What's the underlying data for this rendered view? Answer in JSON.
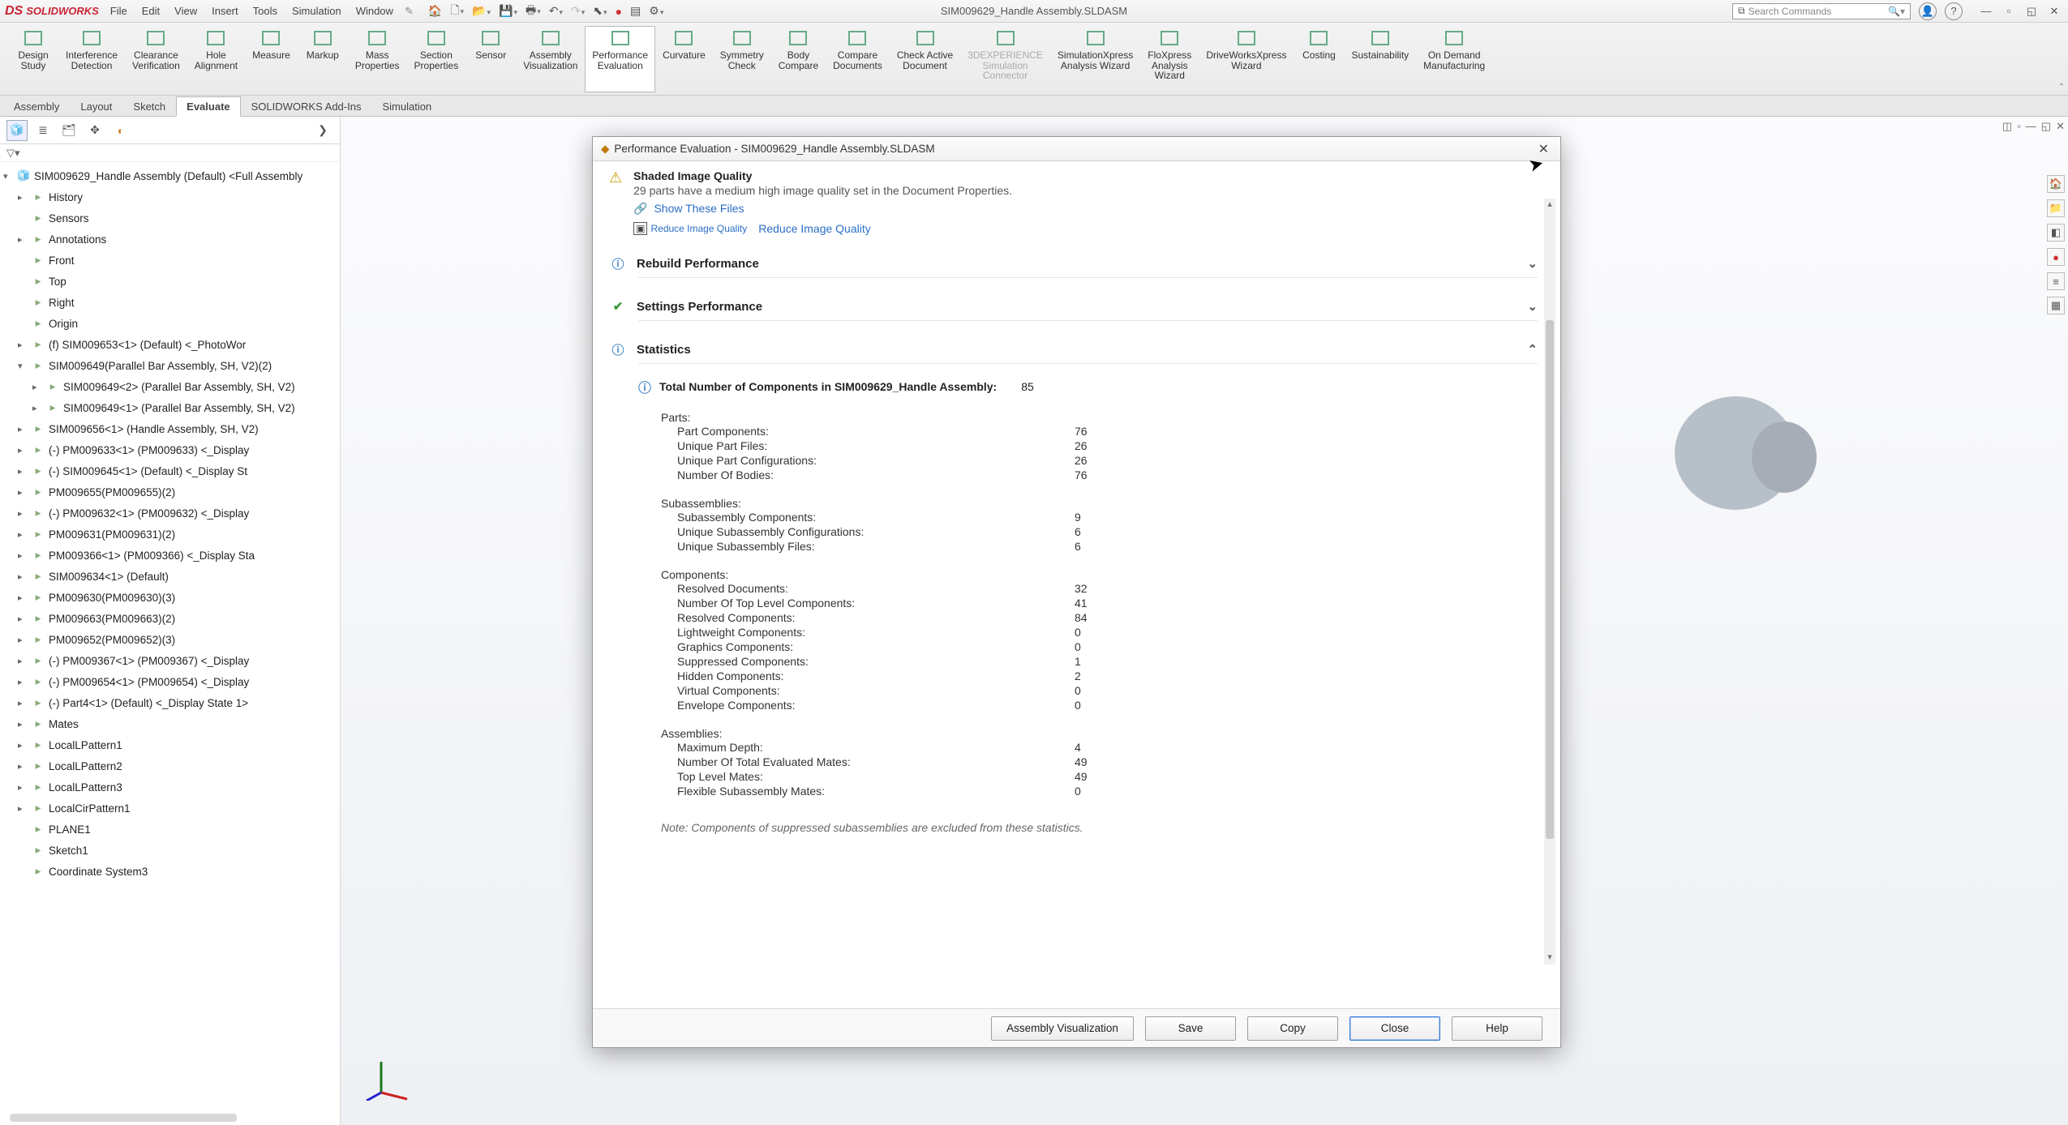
{
  "app": {
    "brand": "SOLIDWORKS",
    "doc_title": "SIM009629_Handle Assembly.SLDASM",
    "search_placeholder": "Search Commands"
  },
  "menus": [
    "File",
    "Edit",
    "View",
    "Insert",
    "Tools",
    "Simulation",
    "Window"
  ],
  "tabs": [
    "Assembly",
    "Layout",
    "Sketch",
    "Evaluate",
    "SOLIDWORKS Add-Ins",
    "Simulation"
  ],
  "active_tab": "Evaluate",
  "ribbon": [
    {
      "id": "design-study",
      "label": "Design\nStudy"
    },
    {
      "id": "interference",
      "label": "Interference\nDetection"
    },
    {
      "id": "clearance",
      "label": "Clearance\nVerification"
    },
    {
      "id": "hole",
      "label": "Hole\nAlignment"
    },
    {
      "id": "measure",
      "label": "Measure"
    },
    {
      "id": "markup",
      "label": "Markup"
    },
    {
      "id": "mass",
      "label": "Mass\nProperties"
    },
    {
      "id": "section",
      "label": "Section\nProperties"
    },
    {
      "id": "sensor",
      "label": "Sensor"
    },
    {
      "id": "asm-vis",
      "label": "Assembly\nVisualization"
    },
    {
      "id": "perf-eval",
      "label": "Performance\nEvaluation",
      "selected": true
    },
    {
      "id": "curvature",
      "label": "Curvature"
    },
    {
      "id": "symmetry",
      "label": "Symmetry\nCheck"
    },
    {
      "id": "body-compare",
      "label": "Body\nCompare"
    },
    {
      "id": "compare-doc",
      "label": "Compare\nDocuments"
    },
    {
      "id": "check-active",
      "label": "Check Active\nDocument"
    },
    {
      "id": "3dx",
      "label": "3DEXPERIENCE\nSimulation\nConnector",
      "disabled": true
    },
    {
      "id": "simx",
      "label": "SimulationXpress\nAnalysis Wizard"
    },
    {
      "id": "flox",
      "label": "FloXpress\nAnalysis\nWizard"
    },
    {
      "id": "dwx",
      "label": "DriveWorksXpress\nWizard"
    },
    {
      "id": "costing",
      "label": "Costing"
    },
    {
      "id": "sust",
      "label": "Sustainability"
    },
    {
      "id": "odm",
      "label": "On Demand\nManufacturing"
    }
  ],
  "tree_root": "SIM009629_Handle Assembly (Default) <Full Assembly",
  "tree": [
    {
      "d": 2,
      "l": "History",
      "ar": "▸"
    },
    {
      "d": 2,
      "l": "Sensors"
    },
    {
      "d": 2,
      "l": "Annotations",
      "ar": "▸"
    },
    {
      "d": 2,
      "l": "Front"
    },
    {
      "d": 2,
      "l": "Top"
    },
    {
      "d": 2,
      "l": "Right"
    },
    {
      "d": 2,
      "l": "Origin"
    },
    {
      "d": 2,
      "l": "(f) SIM009653<1> (Default) <<Default>_PhotoWor",
      "ar": "▸"
    },
    {
      "d": 2,
      "l": "SIM009649(Parallel Bar Assembly, SH, V2)(2)",
      "ar": "▾"
    },
    {
      "d": 3,
      "l": "SIM009649<2> (Parallel Bar Assembly, SH, V2)",
      "ar": "▸"
    },
    {
      "d": 3,
      "l": "SIM009649<1> (Parallel Bar Assembly, SH, V2)",
      "ar": "▸"
    },
    {
      "d": 2,
      "l": "SIM009656<1> (Handle Assembly, SH, V2) <Displa",
      "ar": "▸"
    },
    {
      "d": 2,
      "l": "(-) PM009633<1> (PM009633) <<Default>_Display",
      "ar": "▸"
    },
    {
      "d": 2,
      "l": "(-) SIM009645<1> (Default) <<Default>_Display St",
      "ar": "▸"
    },
    {
      "d": 2,
      "l": "PM009655(PM009655)(2)",
      "ar": "▸"
    },
    {
      "d": 2,
      "l": "(-) PM009632<1> (PM009632) <<Default>_Display",
      "ar": "▸"
    },
    {
      "d": 2,
      "l": "PM009631(PM009631)(2)",
      "ar": "▸"
    },
    {
      "d": 2,
      "l": "PM009366<1> (PM009366) <<Default>_Display Sta",
      "ar": "▸"
    },
    {
      "d": 2,
      "l": "SIM009634<1> (Default) <Display State-1>",
      "ar": "▸"
    },
    {
      "d": 2,
      "l": "PM009630(PM009630)(3)",
      "ar": "▸"
    },
    {
      "d": 2,
      "l": "PM009663(PM009663)(2)",
      "ar": "▸"
    },
    {
      "d": 2,
      "l": "PM009652(PM009652)(3)",
      "ar": "▸"
    },
    {
      "d": 2,
      "l": "(-) PM009367<1> (PM009367) <<Default>_Display",
      "ar": "▸"
    },
    {
      "d": 2,
      "l": "(-) PM009654<1> (PM009654) <<Default>_Display",
      "ar": "▸"
    },
    {
      "d": 2,
      "l": "(-) Part4<1> (Default) <<Default>_Display State 1>",
      "ar": "▸"
    },
    {
      "d": 2,
      "l": "Mates",
      "ar": "▸"
    },
    {
      "d": 2,
      "l": "LocalLPattern1",
      "ar": "▸"
    },
    {
      "d": 2,
      "l": "LocalLPattern2",
      "ar": "▸"
    },
    {
      "d": 2,
      "l": "LocalLPattern3",
      "ar": "▸"
    },
    {
      "d": 2,
      "l": "LocalCirPattern1",
      "ar": "▸"
    },
    {
      "d": 2,
      "l": "PLANE1"
    },
    {
      "d": 2,
      "l": "Sketch1"
    },
    {
      "d": 2,
      "l": "Coordinate System3"
    }
  ],
  "dialog": {
    "title": "Performance Evaluation - SIM009629_Handle Assembly.SLDASM",
    "shaded": {
      "heading": "Shaded Image Quality",
      "msg": "29 parts have a medium high image quality set in the Document Properties.",
      "link1": "Show These Files",
      "icon_label": "Reduce Image Quality",
      "link2": "Reduce Image Quality"
    },
    "sections": [
      {
        "id": "rebuild",
        "title": "Rebuild Performance",
        "icon": "info",
        "chev": "⌄"
      },
      {
        "id": "settings",
        "title": "Settings Performance",
        "icon": "ok",
        "chev": "⌄"
      },
      {
        "id": "stats",
        "title": "Statistics",
        "icon": "info",
        "chev": "⌃"
      }
    ],
    "stats_title": "Total Number of Components in SIM009629_Handle Assembly:",
    "stats_title_val": "85",
    "groups": [
      {
        "title": "Parts:",
        "rows": [
          {
            "k": "Part Components:",
            "v": "76"
          },
          {
            "k": "Unique Part Files:",
            "v": "26"
          },
          {
            "k": "Unique Part Configurations:",
            "v": "26"
          },
          {
            "k": "Number Of Bodies:",
            "v": "76"
          }
        ]
      },
      {
        "title": "Subassemblies:",
        "rows": [
          {
            "k": "Subassembly Components:",
            "v": "9"
          },
          {
            "k": "Unique Subassembly Configurations:",
            "v": "6"
          },
          {
            "k": "Unique Subassembly Files:",
            "v": "6"
          }
        ]
      },
      {
        "title": "Components:",
        "rows": [
          {
            "k": "Resolved Documents:",
            "v": "32"
          },
          {
            "k": "Number Of Top Level Components:",
            "v": "41"
          },
          {
            "k": "Resolved Components:",
            "v": "84"
          },
          {
            "k": "Lightweight Components:",
            "v": "0"
          },
          {
            "k": "Graphics Components:",
            "v": "0"
          },
          {
            "k": "Suppressed Components:",
            "v": "1"
          },
          {
            "k": "Hidden Components:",
            "v": "2"
          },
          {
            "k": "Virtual Components:",
            "v": "0"
          },
          {
            "k": "Envelope Components:",
            "v": "0"
          }
        ]
      },
      {
        "title": "Assemblies:",
        "rows": [
          {
            "k": "Maximum Depth:",
            "v": "4"
          },
          {
            "k": "Number Of Total Evaluated Mates:",
            "v": "49"
          },
          {
            "k": "Top Level Mates:",
            "v": "49"
          },
          {
            "k": "Flexible Subassembly Mates:",
            "v": "0"
          }
        ]
      }
    ],
    "note": "Note: Components of suppressed subassemblies are excluded from these statistics.",
    "buttons": {
      "av": "Assembly Visualization",
      "save": "Save",
      "copy": "Copy",
      "close": "Close",
      "help": "Help"
    }
  }
}
